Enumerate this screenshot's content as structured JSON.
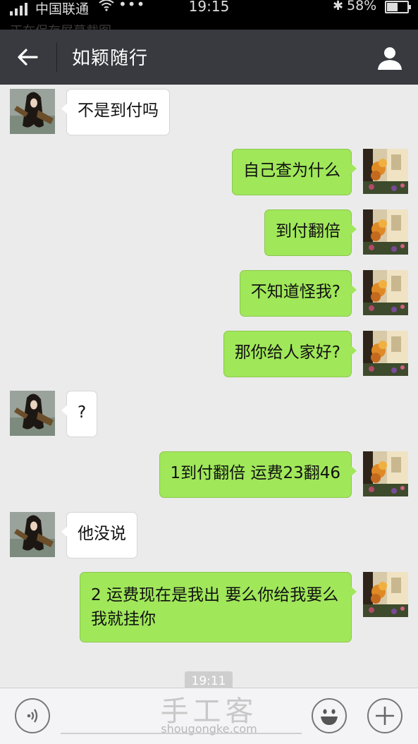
{
  "status_bar": {
    "carrier": "中国联通",
    "dots": "•••",
    "time": "19:15",
    "bluetooth": "✱",
    "battery_percent": "58%",
    "battery_level": 0.58,
    "ghost_text": "正在保存屏幕截图..."
  },
  "header": {
    "title": "如颖随行"
  },
  "messages": [
    {
      "side": "left",
      "text": "不是到付吗"
    },
    {
      "side": "right",
      "text": "自己查为什么"
    },
    {
      "side": "right",
      "text": "到付翻倍"
    },
    {
      "side": "right",
      "text": "不知道怪我?"
    },
    {
      "side": "right",
      "text": "那你给人家好?"
    },
    {
      "side": "left",
      "text": "?"
    },
    {
      "side": "right",
      "text": "1到付翻倍 运费23翻46"
    },
    {
      "side": "left",
      "text": "他没说"
    },
    {
      "side": "right",
      "text": "2 运费现在是我出 要么你给我要么我就挂你"
    }
  ],
  "timestamp": "19:11",
  "watermark": {
    "title": "手工客",
    "url": "shougongke.com"
  },
  "colors": {
    "title_bar": "#393a3f",
    "chat_bg": "#ebebeb",
    "sent_bubble": "#a0e75a",
    "received_bubble": "#ffffff"
  }
}
